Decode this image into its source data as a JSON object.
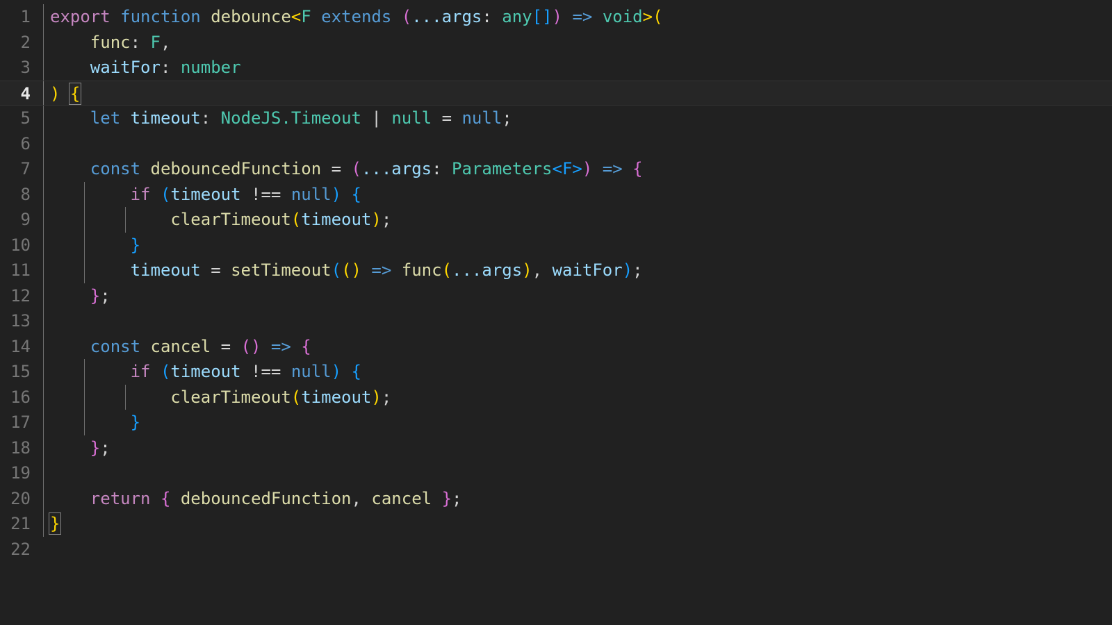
{
  "editor": {
    "language": "typescript",
    "theme": "dark-plus",
    "background_color": "#212121",
    "active_line_number": 4,
    "total_lines": 22,
    "font_size_px": 24,
    "tab_size": 4,
    "gutter": {
      "line_numbers": [
        "1",
        "2",
        "3",
        "4",
        "5",
        "6",
        "7",
        "8",
        "9",
        "10",
        "11",
        "12",
        "13",
        "14",
        "15",
        "16",
        "17",
        "18",
        "19",
        "20",
        "21",
        "22"
      ],
      "inactive_color": "#767676",
      "active_color": "#e8e8e8"
    },
    "bracket_match": {
      "open_line": 4,
      "open_char": "{",
      "close_line": 21,
      "close_char": "}",
      "outline_color": "#888888"
    },
    "token_colors": {
      "keyword_control": "#C586C0",
      "keyword_declaration": "#569CD6",
      "function_name": "#DCDCAA",
      "type_name": "#4EC9B0",
      "variable": "#9CDCFE",
      "operator": "#d4d4d4",
      "bracket_level_1": "#FFD700",
      "bracket_level_2": "#DA70D6",
      "bracket_level_3": "#179FFF"
    },
    "lines": {
      "1": "export function debounce<F extends (...args: any[]) => void>(",
      "2": "    func: F,",
      "3": "    waitFor: number",
      "4": ") {",
      "5": "    let timeout: NodeJS.Timeout | null = null;",
      "6": "",
      "7": "    const debouncedFunction = (...args: Parameters<F>) => {",
      "8": "        if (timeout !== null) {",
      "9": "            clearTimeout(timeout);",
      "10": "        }",
      "11": "        timeout = setTimeout(() => func(...args), waitFor);",
      "12": "    };",
      "13": "",
      "14": "    const cancel = () => {",
      "15": "        if (timeout !== null) {",
      "16": "            clearTimeout(timeout);",
      "17": "        }",
      "18": "    };",
      "19": "",
      "20": "    return { debouncedFunction, cancel };",
      "21": "}",
      "22": ""
    },
    "tokens": {
      "l1": {
        "t1": "export",
        "t2": "function",
        "t3": "debounce",
        "t4": "<",
        "t5": "F",
        "t6": "extends",
        "t7": "(",
        "t8": "...args",
        "t9": ":",
        "t10": "any",
        "t11": "[]",
        "t12": ")",
        "t13": "=>",
        "t14": "void",
        "t15": ">",
        "t16": "("
      },
      "l2": {
        "t1": "func",
        "t2": ":",
        "t3": "F",
        "t4": ","
      },
      "l3": {
        "t1": "waitFor",
        "t2": ":",
        "t3": "number"
      },
      "l4": {
        "t1": ")",
        "t2": "{"
      },
      "l5": {
        "t1": "let",
        "t2": "timeout",
        "t3": ":",
        "t4": "NodeJS.Timeout",
        "t5": "|",
        "t6": "null",
        "t7": "=",
        "t8": "null",
        "t9": ";"
      },
      "l7": {
        "t1": "const",
        "t2": "debouncedFunction",
        "t3": "=",
        "t4": "(",
        "t5": "...args",
        "t6": ":",
        "t7": "Parameters",
        "t8": "<F>",
        "t9": ")",
        "t10": "=>",
        "t11": "{"
      },
      "l8": {
        "t1": "if",
        "t2": "(",
        "t3": "timeout",
        "t4": "!==",
        "t5": "null",
        "t6": ")",
        "t7": "{"
      },
      "l9": {
        "t1": "clearTimeout",
        "t2": "(",
        "t3": "timeout",
        "t4": ")",
        "t5": ";"
      },
      "l10": {
        "t1": "}"
      },
      "l11": {
        "t1": "timeout",
        "t2": "=",
        "t3": "setTimeout",
        "t4": "(",
        "t5": "()",
        "t6": "=>",
        "t7": "func",
        "t8": "(",
        "t9": "...args",
        "t10": ")",
        "t11": ",",
        "t12": "waitFor",
        "t13": ")",
        "t14": ";"
      },
      "l12": {
        "t1": "}",
        "t2": ";"
      },
      "l14": {
        "t1": "const",
        "t2": "cancel",
        "t3": "=",
        "t4": "()",
        "t5": "=>",
        "t6": "{"
      },
      "l15": {
        "t1": "if",
        "t2": "(",
        "t3": "timeout",
        "t4": "!==",
        "t5": "null",
        "t6": ")",
        "t7": "{"
      },
      "l16": {
        "t1": "clearTimeout",
        "t2": "(",
        "t3": "timeout",
        "t4": ")",
        "t5": ";"
      },
      "l17": {
        "t1": "}"
      },
      "l18": {
        "t1": "}",
        "t2": ";"
      },
      "l20": {
        "t1": "return",
        "t2": "{",
        "t3": "debouncedFunction",
        "t4": ",",
        "t5": "cancel",
        "t6": "}",
        "t7": ";"
      },
      "l21": {
        "t1": "}"
      }
    }
  }
}
